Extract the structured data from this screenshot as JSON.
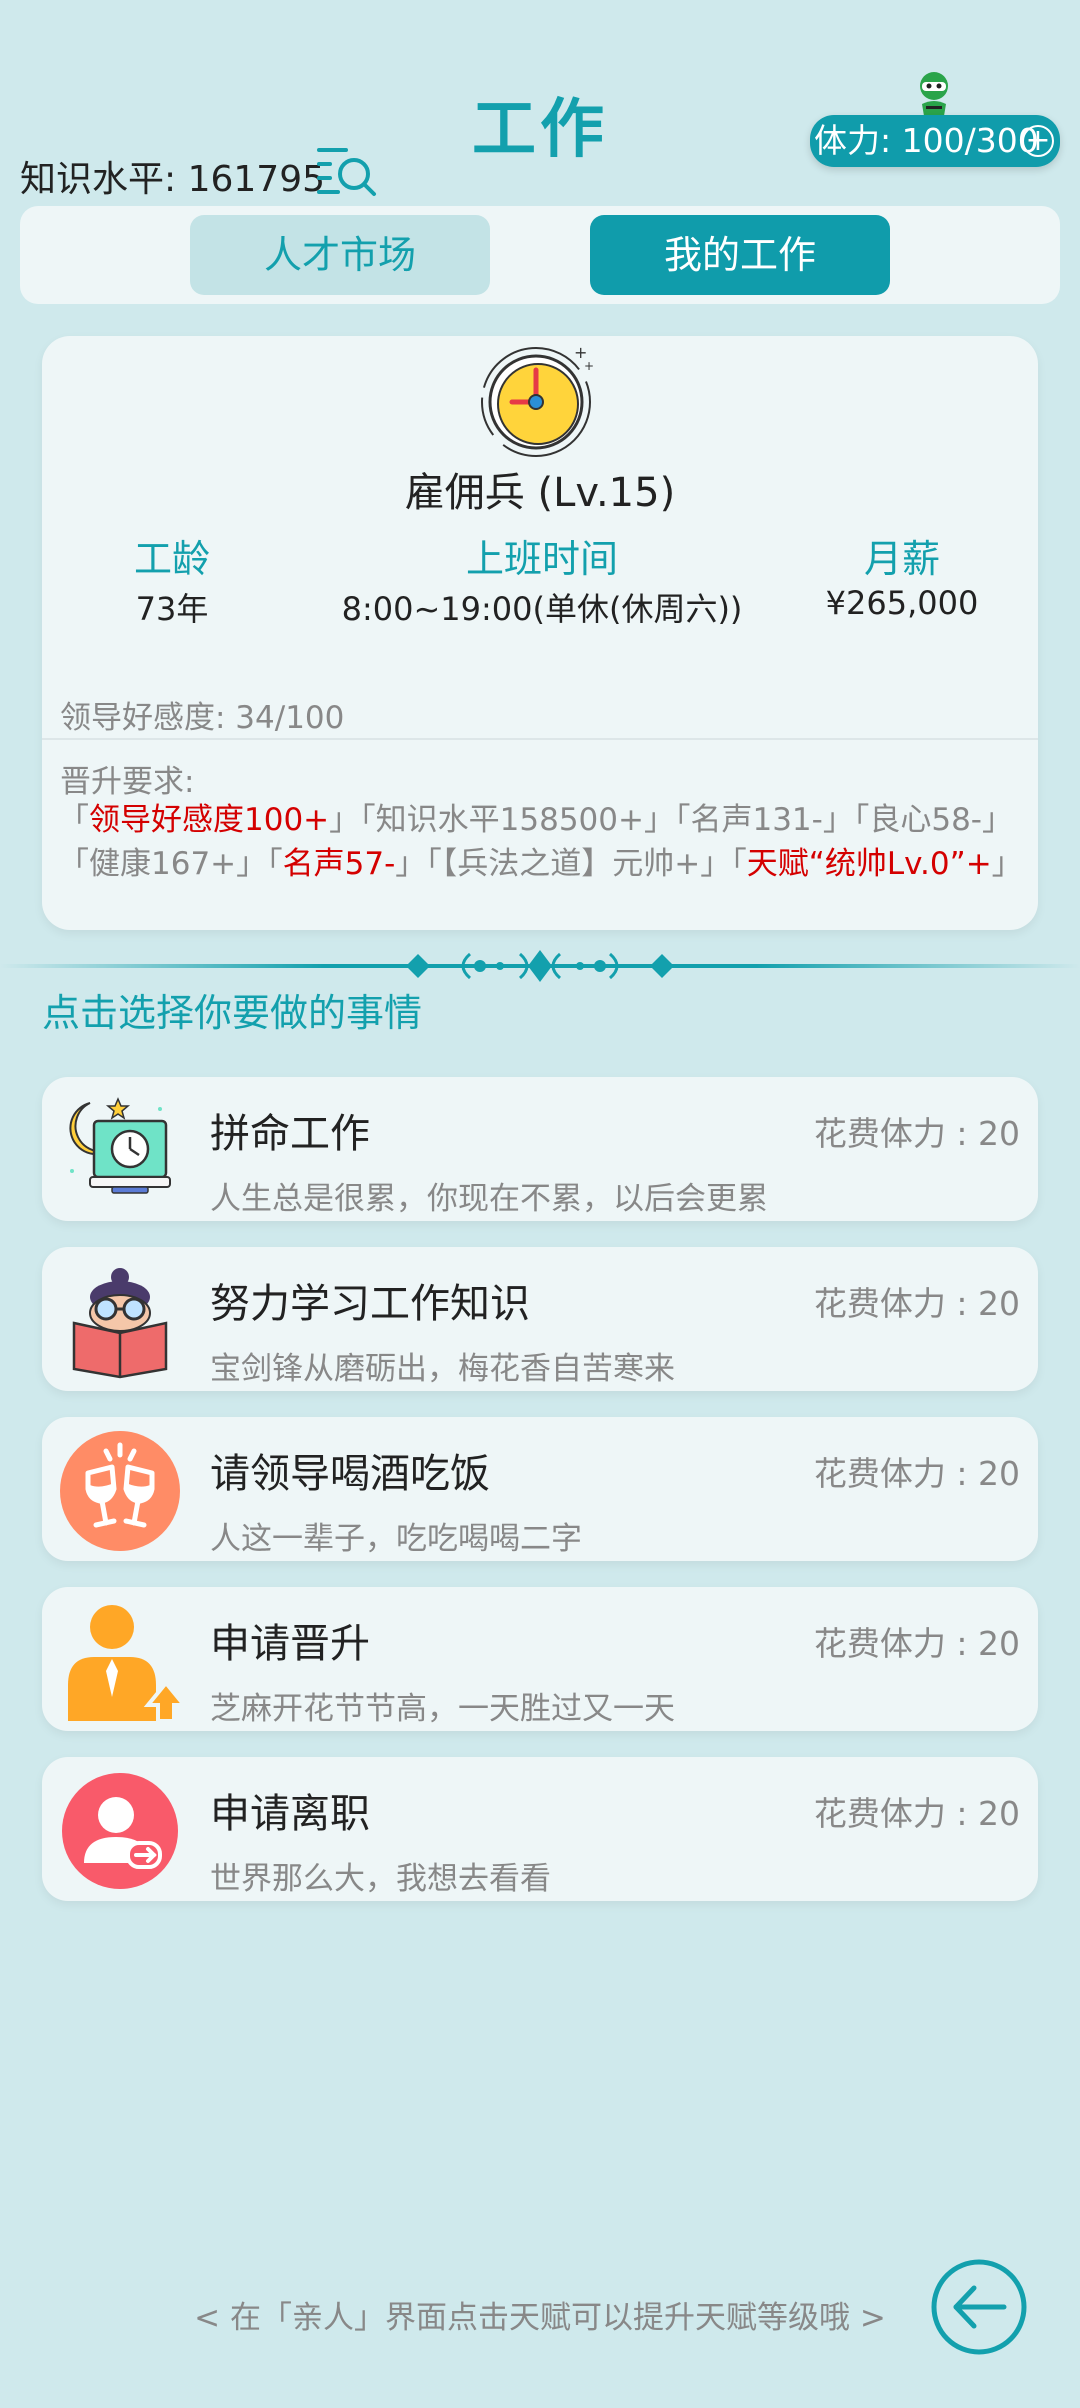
{
  "header": {
    "title": "工作",
    "knowledge_label": "知识水平: 161795",
    "stamina_label": "体力: 100/300",
    "stamina_plus": "+"
  },
  "tabs": [
    {
      "label": "人才市场",
      "active": false
    },
    {
      "label": "我的工作",
      "active": true
    }
  ],
  "job": {
    "title": "雇佣兵 (Lv.15)",
    "stats": [
      {
        "label": "工龄",
        "value": "73年"
      },
      {
        "label": "上班时间",
        "value": "8:00~19:00(单休(休周六))"
      },
      {
        "label": "月薪",
        "value": "¥265,000"
      }
    ],
    "favor": "领导好感度: 34/100",
    "promotion_label": "晋升要求:",
    "requirements": [
      {
        "text": "领导好感度100+",
        "unmet": true
      },
      {
        "text": "知识水平158500+",
        "unmet": false
      },
      {
        "text": "名声131-",
        "unmet": false
      },
      {
        "text": "良心58-",
        "unmet": false
      },
      {
        "text": "健康167+",
        "unmet": false
      },
      {
        "text": "名声57-",
        "unmet": true
      },
      {
        "text": "【兵法之道】元帅+",
        "unmet": false
      },
      {
        "text": "天赋“统帅Lv.0”+",
        "unmet": true
      }
    ]
  },
  "instruction": "点击选择你要做的事情",
  "actions": [
    {
      "name": "拼命工作",
      "cost": "花费体力 : 20",
      "desc": "人生总是很累，你现在不累，以后会更累",
      "icon": "moon-computer-icon"
    },
    {
      "name": "努力学习工作知识",
      "cost": "花费体力 : 20",
      "desc": "宝剑锋从磨砺出，梅花香自苦寒来",
      "icon": "reading-student-icon"
    },
    {
      "name": "请领导喝酒吃饭",
      "cost": "花费体力 : 20",
      "desc": "人这一辈子，吃吃喝喝二字",
      "icon": "cheers-glasses-icon"
    },
    {
      "name": "申请晋升",
      "cost": "花费体力 : 20",
      "desc": "芝麻开花节节高，一天胜过又一天",
      "icon": "promotion-person-icon"
    },
    {
      "name": "申请离职",
      "cost": "花费体力 : 20",
      "desc": "世界那么大，我想去看看",
      "icon": "resign-user-icon"
    }
  ],
  "footer": {
    "hint": "< 在「亲人」界面点击天赋可以提升天赋等级哦 >"
  },
  "colors": {
    "background": "#cfe9ec",
    "accent": "#109cab",
    "unmet_requirement": "#d40000"
  }
}
